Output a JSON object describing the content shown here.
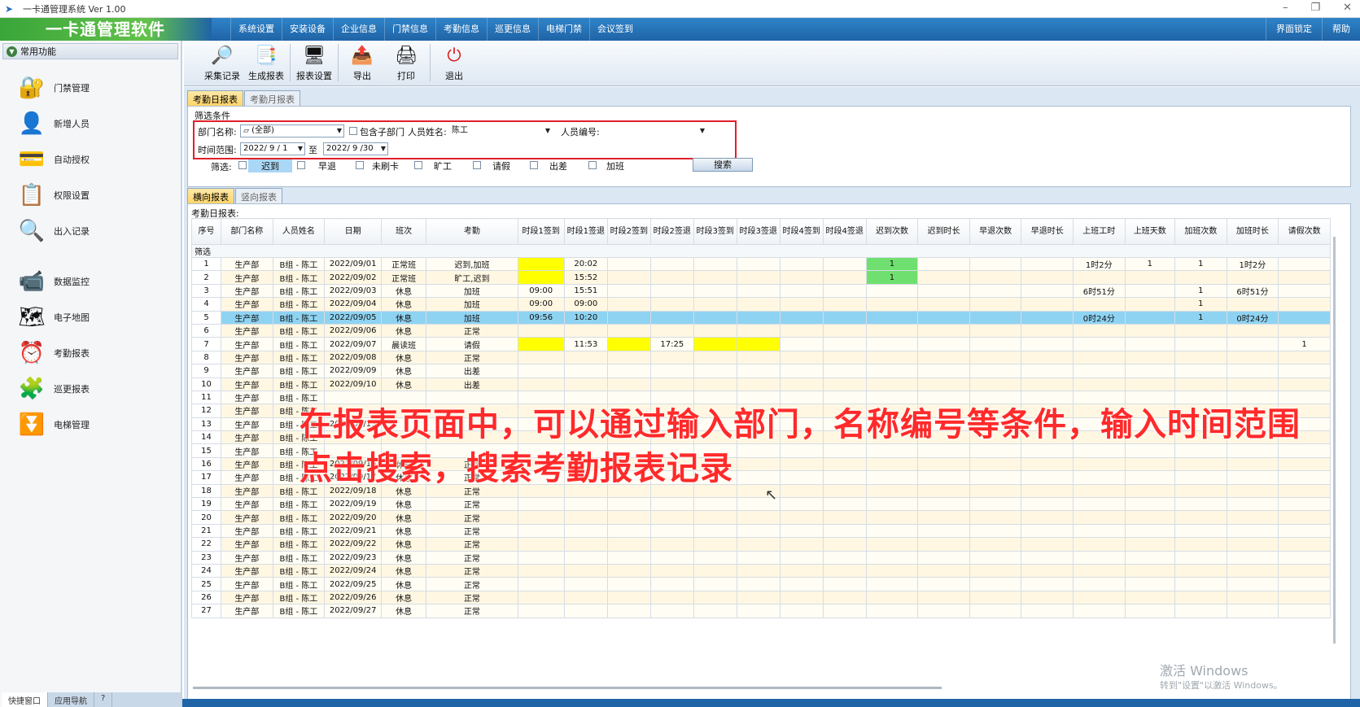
{
  "window": {
    "title": "一卡通管理系统  Ver 1.00",
    "controls": [
      "–",
      "❐",
      "✕"
    ]
  },
  "menubar": {
    "logo": "一卡通管理软件",
    "items": [
      "系统设置",
      "安装设备",
      "企业信息",
      "门禁信息",
      "考勤信息",
      "巡更信息",
      "电梯门禁",
      "会议签到"
    ],
    "right_items": [
      "界面锁定",
      "帮助"
    ]
  },
  "sidebar": {
    "header": "常用功能",
    "items": [
      {
        "label": "门禁管理",
        "icon": "door-access-icon"
      },
      {
        "label": "新增人员",
        "icon": "person-icon"
      },
      {
        "label": "自动授权",
        "icon": "card-icon"
      },
      {
        "label": "权限设置",
        "icon": "permission-icon"
      },
      {
        "label": "出入记录",
        "icon": "magnifier-icon"
      },
      {
        "label": "数据监控",
        "icon": "camera-icon"
      },
      {
        "label": "电子地图",
        "icon": "map-icon"
      },
      {
        "label": "考勤报表",
        "icon": "clock-icon"
      },
      {
        "label": "巡更报表",
        "icon": "patrol-icon"
      },
      {
        "label": "电梯管理",
        "icon": "elevator-icon"
      }
    ],
    "bottom_tabs": [
      "快捷窗口",
      "应用导航",
      "?"
    ]
  },
  "toolbar": {
    "buttons": [
      {
        "label": "采集记录",
        "icon": "magnifier-icon"
      },
      {
        "label": "生成报表",
        "icon": "report-icon"
      },
      {
        "label": "报表设置",
        "icon": "settings-icon"
      },
      {
        "label": "导出",
        "icon": "export-icon"
      },
      {
        "label": "打印",
        "icon": "printer-icon"
      },
      {
        "label": "退出",
        "icon": "power-icon"
      }
    ]
  },
  "report_tabs": [
    "考勤日报表",
    "考勤月报表"
  ],
  "filter": {
    "title": "筛选条件",
    "dept_label": "部门名称:",
    "dept_value": "(全部)",
    "include_sub_label": "包含子部门",
    "name_label": "人员姓名:",
    "name_value": "陈工",
    "id_label": "人员编号:",
    "id_value": "",
    "time_label": "时间范围:",
    "date_from": "2022/ 9 / 1",
    "to_label": "至",
    "date_to": "2022/ 9 /30",
    "screen_label": "筛选:",
    "checks": [
      "迟到",
      "早退",
      "未刷卡",
      "旷工",
      "请假",
      "出差",
      "加班"
    ],
    "search_label": "搜索"
  },
  "view_tabs": [
    "横向报表",
    "竖向报表"
  ],
  "grid": {
    "caption": "考勤日报表:",
    "filter_row_label": "筛选",
    "columns": [
      "序号",
      "部门名称",
      "人员姓名",
      "日期",
      "班次",
      "考勤",
      "时段1签到",
      "时段1签退",
      "时段2签到",
      "时段2签退",
      "时段3签到",
      "时段3签退",
      "时段4签到",
      "时段4签退",
      "迟到次数",
      "迟到时长",
      "早退次数",
      "早退时长",
      "上班工时",
      "上班天数",
      "加班次数",
      "加班时长",
      "请假次数"
    ],
    "rows": [
      [
        "1",
        "生产部",
        "B组 - 陈工",
        "2022/09/01",
        "正常班",
        "迟到,加班",
        "",
        "20:02",
        "",
        "",
        "",
        "",
        "",
        "",
        "1",
        "",
        "",
        "",
        "1时2分",
        "1",
        "1",
        "1时2分",
        ""
      ],
      [
        "2",
        "生产部",
        "B组 - 陈工",
        "2022/09/02",
        "正常班",
        "旷工,迟到",
        "",
        "15:52",
        "",
        "",
        "",
        "",
        "",
        "",
        "1",
        "",
        "",
        "",
        "",
        "",
        "",
        "",
        ""
      ],
      [
        "3",
        "生产部",
        "B组 - 陈工",
        "2022/09/03",
        "休息",
        "加班",
        "09:00",
        "15:51",
        "",
        "",
        "",
        "",
        "",
        "",
        "",
        "",
        "",
        "",
        "6时51分",
        "",
        "1",
        "6时51分",
        ""
      ],
      [
        "4",
        "生产部",
        "B组 - 陈工",
        "2022/09/04",
        "休息",
        "加班",
        "09:00",
        "09:00",
        "",
        "",
        "",
        "",
        "",
        "",
        "",
        "",
        "",
        "",
        "",
        "",
        "1",
        "",
        ""
      ],
      [
        "5",
        "生产部",
        "B组 - 陈工",
        "2022/09/05",
        "休息",
        "加班",
        "09:56",
        "10:20",
        "",
        "",
        "",
        "",
        "",
        "",
        "",
        "",
        "",
        "",
        "0时24分",
        "",
        "1",
        "0时24分",
        ""
      ],
      [
        "6",
        "生产部",
        "B组 - 陈工",
        "2022/09/06",
        "休息",
        "正常",
        "",
        "",
        "",
        "",
        "",
        "",
        "",
        "",
        "",
        "",
        "",
        "",
        "",
        "",
        "",
        "",
        ""
      ],
      [
        "7",
        "生产部",
        "B组 - 陈工",
        "2022/09/07",
        "晨读班",
        "请假",
        "",
        "11:53",
        "",
        "17:25",
        "",
        "",
        "",
        "",
        "",
        "",
        "",
        "",
        "",
        "",
        "",
        "",
        "1"
      ],
      [
        "8",
        "生产部",
        "B组 - 陈工",
        "2022/09/08",
        "休息",
        "正常",
        "",
        "",
        "",
        "",
        "",
        "",
        "",
        "",
        "",
        "",
        "",
        "",
        "",
        "",
        "",
        "",
        ""
      ],
      [
        "9",
        "生产部",
        "B组 - 陈工",
        "2022/09/09",
        "休息",
        "出差",
        "",
        "",
        "",
        "",
        "",
        "",
        "",
        "",
        "",
        "",
        "",
        "",
        "",
        "",
        "",
        "",
        ""
      ],
      [
        "10",
        "生产部",
        "B组 - 陈工",
        "2022/09/10",
        "休息",
        "出差",
        "",
        "",
        "",
        "",
        "",
        "",
        "",
        "",
        "",
        "",
        "",
        "",
        "",
        "",
        "",
        "",
        ""
      ],
      [
        "11",
        "生产部",
        "B组 - 陈工",
        "",
        "",
        "",
        "",
        "",
        "",
        "",
        "",
        "",
        "",
        "",
        "",
        "",
        "",
        "",
        "",
        "",
        "",
        "",
        ""
      ],
      [
        "12",
        "生产部",
        "B组 - 陈工",
        "",
        "",
        "",
        "",
        "",
        "",
        "",
        "",
        "",
        "",
        "",
        "",
        "",
        "",
        "",
        "",
        "",
        "",
        "",
        ""
      ],
      [
        "13",
        "生产部",
        "B组 - 陈工",
        "2022/09/13",
        "",
        "",
        "",
        "",
        "",
        "",
        "",
        "",
        "",
        "",
        "",
        "",
        "",
        "",
        "",
        "",
        "",
        "",
        ""
      ],
      [
        "14",
        "生产部",
        "B组 - 陈工",
        "",
        "",
        "",
        "",
        "",
        "",
        "",
        "",
        "",
        "",
        "",
        "",
        "",
        "",
        "",
        "",
        "",
        "",
        "",
        ""
      ],
      [
        "15",
        "生产部",
        "B组 - 陈工",
        "",
        "",
        "",
        "",
        "",
        "",
        "",
        "",
        "",
        "",
        "",
        "",
        "",
        "",
        "",
        "",
        "",
        "",
        "",
        ""
      ],
      [
        "16",
        "生产部",
        "B组 - 陈工",
        "2022/09/16",
        "休息",
        "正常",
        "",
        "",
        "",
        "",
        "",
        "",
        "",
        "",
        "",
        "",
        "",
        "",
        "",
        "",
        "",
        "",
        ""
      ],
      [
        "17",
        "生产部",
        "B组 - 陈工",
        "2022/09/17",
        "休息",
        "正常",
        "",
        "",
        "",
        "",
        "",
        "",
        "",
        "",
        "",
        "",
        "",
        "",
        "",
        "",
        "",
        "",
        ""
      ],
      [
        "18",
        "生产部",
        "B组 - 陈工",
        "2022/09/18",
        "休息",
        "正常",
        "",
        "",
        "",
        "",
        "",
        "",
        "",
        "",
        "",
        "",
        "",
        "",
        "",
        "",
        "",
        "",
        ""
      ],
      [
        "19",
        "生产部",
        "B组 - 陈工",
        "2022/09/19",
        "休息",
        "正常",
        "",
        "",
        "",
        "",
        "",
        "",
        "",
        "",
        "",
        "",
        "",
        "",
        "",
        "",
        "",
        "",
        ""
      ],
      [
        "20",
        "生产部",
        "B组 - 陈工",
        "2022/09/20",
        "休息",
        "正常",
        "",
        "",
        "",
        "",
        "",
        "",
        "",
        "",
        "",
        "",
        "",
        "",
        "",
        "",
        "",
        "",
        ""
      ],
      [
        "21",
        "生产部",
        "B组 - 陈工",
        "2022/09/21",
        "休息",
        "正常",
        "",
        "",
        "",
        "",
        "",
        "",
        "",
        "",
        "",
        "",
        "",
        "",
        "",
        "",
        "",
        "",
        ""
      ],
      [
        "22",
        "生产部",
        "B组 - 陈工",
        "2022/09/22",
        "休息",
        "正常",
        "",
        "",
        "",
        "",
        "",
        "",
        "",
        "",
        "",
        "",
        "",
        "",
        "",
        "",
        "",
        "",
        ""
      ],
      [
        "23",
        "生产部",
        "B组 - 陈工",
        "2022/09/23",
        "休息",
        "正常",
        "",
        "",
        "",
        "",
        "",
        "",
        "",
        "",
        "",
        "",
        "",
        "",
        "",
        "",
        "",
        "",
        ""
      ],
      [
        "24",
        "生产部",
        "B组 - 陈工",
        "2022/09/24",
        "休息",
        "正常",
        "",
        "",
        "",
        "",
        "",
        "",
        "",
        "",
        "",
        "",
        "",
        "",
        "",
        "",
        "",
        "",
        ""
      ],
      [
        "25",
        "生产部",
        "B组 - 陈工",
        "2022/09/25",
        "休息",
        "正常",
        "",
        "",
        "",
        "",
        "",
        "",
        "",
        "",
        "",
        "",
        "",
        "",
        "",
        "",
        "",
        "",
        ""
      ],
      [
        "26",
        "生产部",
        "B组 - 陈工",
        "2022/09/26",
        "休息",
        "正常",
        "",
        "",
        "",
        "",
        "",
        "",
        "",
        "",
        "",
        "",
        "",
        "",
        "",
        "",
        "",
        "",
        ""
      ],
      [
        "27",
        "生产部",
        "B组 - 陈工",
        "2022/09/27",
        "休息",
        "正常",
        "",
        "",
        "",
        "",
        "",
        "",
        "",
        "",
        "",
        "",
        "",
        "",
        "",
        "",
        "",
        "",
        ""
      ]
    ],
    "selected_row": 5,
    "yellow_cells": [
      [
        1,
        6
      ],
      [
        2,
        6
      ],
      [
        7,
        6
      ],
      [
        7,
        8
      ],
      [
        7,
        10
      ],
      [
        7,
        11
      ]
    ],
    "green_cells": [
      [
        1,
        14
      ],
      [
        2,
        14
      ]
    ],
    "colors": {
      "selected": "#8fd3f2",
      "yellow": "#ffff00",
      "green": "#6fe06f",
      "accent": "#1f64a6"
    }
  },
  "overlay": {
    "line1": "在报表页面中，可以通过输入部门，名称编号等条件，输入时间范围",
    "line2": "点击搜索，搜索考勤报表记录"
  },
  "watermark": {
    "line1": "激活 Windows",
    "line2": "转到\"设置\"以激活 Windows。"
  }
}
